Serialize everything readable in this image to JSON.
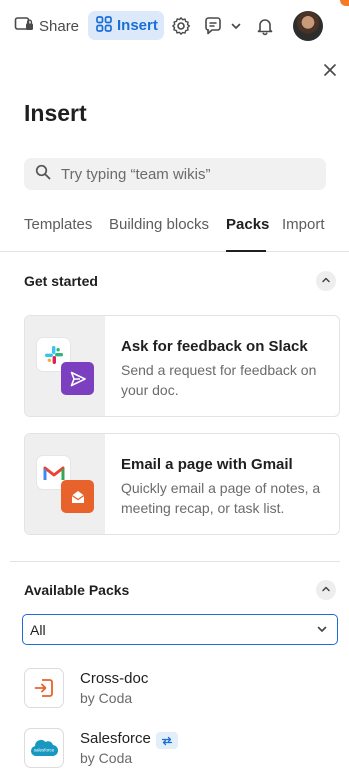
{
  "toolbar": {
    "share_label": "Share",
    "insert_label": "Insert",
    "icons": [
      "share-doc-icon",
      "insert-grid-icon",
      "gear-icon",
      "comment-icon",
      "chevron-down-icon",
      "bell-icon",
      "avatar"
    ]
  },
  "panel": {
    "title": "Insert",
    "search_placeholder": "Try typing “team wikis”"
  },
  "tabs": [
    {
      "label": "Templates"
    },
    {
      "label": "Building blocks"
    },
    {
      "label": "Packs",
      "active": true
    },
    {
      "label": "Import"
    }
  ],
  "get_started": {
    "heading": "Get started",
    "cards": [
      {
        "title": "Ask for feedback on Slack",
        "description": "Send a request for feedback on your doc.",
        "icons": [
          "slack-icon",
          "send-icon"
        ]
      },
      {
        "title": "Email a page with Gmail",
        "description": "Quickly email a page of notes, a meeting recap, or task list.",
        "icons": [
          "gmail-icon",
          "mail-icon"
        ]
      }
    ]
  },
  "available_packs": {
    "heading": "Available Packs",
    "filter_value": "All",
    "packs": [
      {
        "name": "Cross-doc",
        "author": "by Coda",
        "icon": "cross-doc-icon"
      },
      {
        "name": "Salesforce",
        "author": "by Coda",
        "icon": "salesforce-icon",
        "badge_icon": "sync-icon"
      }
    ]
  },
  "colors": {
    "accent": "#1a6fd6",
    "insert_bg": "#dbe9fb",
    "slack_send": "#7b3fbf",
    "gmail_mail": "#e8622c",
    "salesforce": "#1798c1"
  }
}
